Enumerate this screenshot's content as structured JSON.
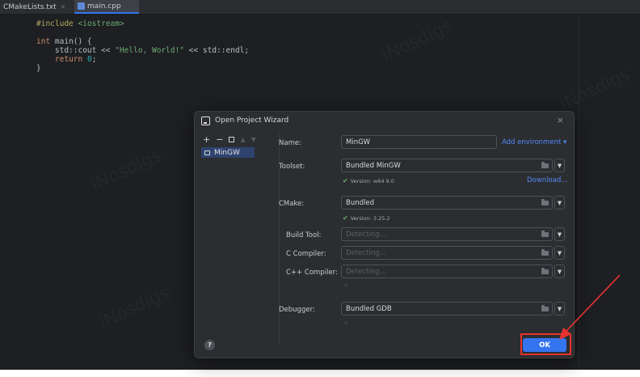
{
  "tabs": [
    {
      "label": "CMakeLists.txt",
      "close": "×"
    },
    {
      "label": "main.cpp"
    }
  ],
  "code_lines": [
    [
      {
        "t": "#include",
        "c": "tk-pre"
      },
      {
        "t": " ",
        "c": ""
      },
      {
        "t": "<iostream>",
        "c": "tk-inc"
      }
    ],
    [],
    [
      {
        "t": "int",
        "c": "tk-kw"
      },
      {
        "t": " main() {",
        "c": ""
      }
    ],
    [
      {
        "t": "    std::cout << ",
        "c": ""
      },
      {
        "t": "\"Hello, World!\"",
        "c": "tk-str"
      },
      {
        "t": " << std::endl;",
        "c": ""
      }
    ],
    [
      {
        "t": "    ",
        "c": ""
      },
      {
        "t": "return",
        "c": "tk-kw"
      },
      {
        "t": " ",
        "c": ""
      },
      {
        "t": "0",
        "c": "tk-num"
      },
      {
        "t": ";",
        "c": ""
      }
    ],
    [
      {
        "t": "}",
        "c": ""
      }
    ]
  ],
  "watermark": "iNosdigs",
  "dialog": {
    "title": "Open Project Wizard",
    "close": "×",
    "toolchains": {
      "add": "+",
      "remove": "−",
      "move_up": "▲",
      "move_down": "▼",
      "items": [
        "MinGW"
      ]
    },
    "name_label": "Name:",
    "name_value": "MinGW",
    "add_environment": "Add environment ▾",
    "toolset_label": "Toolset:",
    "toolset_value": "Bundled MinGW",
    "toolset_version": "Version: w64 9.0",
    "download_link": "Download...",
    "cmake_label": "CMake:",
    "cmake_value": "Bundled",
    "cmake_version": "Version: 3.25.2",
    "build_tool_label": "Build Tool:",
    "build_tool_value": "Detecting...",
    "c_compiler_label": "C Compiler:",
    "c_compiler_value": "Detecting...",
    "cpp_compiler_label": "C++ Compiler:",
    "cpp_compiler_value": "Detecting...",
    "debugger_label": "Debugger:",
    "debugger_value": "Bundled GDB",
    "help": "?",
    "ok": "OK"
  },
  "colors": {
    "accent": "#3574f0",
    "highlight": "#e8332f",
    "check": "#5fb865"
  }
}
